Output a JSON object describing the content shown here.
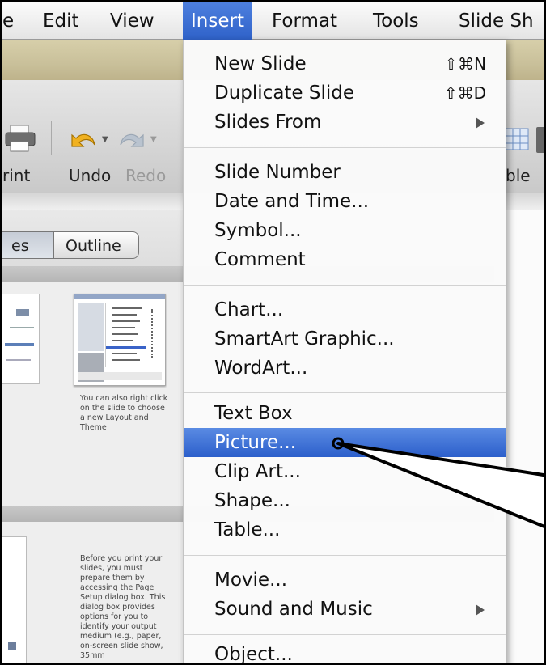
{
  "menubar": {
    "items": [
      {
        "label": "e"
      },
      {
        "label": "Edit"
      },
      {
        "label": "View"
      },
      {
        "label": "Insert"
      },
      {
        "label": "Format"
      },
      {
        "label": "Tools"
      },
      {
        "label": "Slide Sh"
      }
    ]
  },
  "toolbar": {
    "print_label": "rint",
    "undo_label": "Undo",
    "redo_label": "Redo",
    "table_label": "ble"
  },
  "view_tabs": {
    "slides_label": "es",
    "outline_label": "Outline"
  },
  "thumbnails": {
    "caption1": "You can also right click on the slide to choose a new Layout and Theme",
    "caption2": "Before you print your slides, you must prepare them by accessing the Page Setup dialog box. This dialog box provides options for you to identify your output medium (e.g., paper, on-screen slide show, 35mm"
  },
  "insert_menu": {
    "new_slide": {
      "label": "New Slide",
      "shortcut": "⇧⌘N"
    },
    "duplicate_slide": {
      "label": "Duplicate Slide",
      "shortcut": "⇧⌘D"
    },
    "slides_from": {
      "label": "Slides From"
    },
    "slide_number": {
      "label": "Slide Number"
    },
    "date_time": {
      "label": "Date and Time..."
    },
    "symbol": {
      "label": "Symbol..."
    },
    "comment": {
      "label": "Comment"
    },
    "chart": {
      "label": "Chart..."
    },
    "smartart": {
      "label": "SmartArt Graphic..."
    },
    "wordart": {
      "label": "WordArt..."
    },
    "text_box": {
      "label": "Text Box"
    },
    "picture": {
      "label": "Picture..."
    },
    "clip_art": {
      "label": "Clip Art..."
    },
    "shape": {
      "label": "Shape..."
    },
    "table": {
      "label": "Table..."
    },
    "movie": {
      "label": "Movie..."
    },
    "sound_music": {
      "label": "Sound and Music"
    },
    "object": {
      "label": "Object..."
    }
  },
  "colors": {
    "highlight": "#2f62c9",
    "menubar_active": "#3a6fd6"
  },
  "icons": [
    "printer-icon",
    "undo-icon",
    "redo-icon",
    "table-icon",
    "submenu-arrow-icon"
  ]
}
